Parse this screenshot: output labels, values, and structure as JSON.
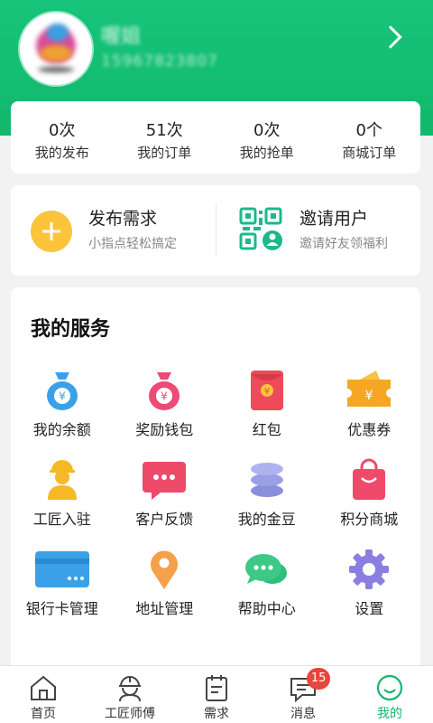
{
  "profile": {
    "name": "喔姐",
    "phone": "15967823807"
  },
  "stats": [
    {
      "value": "0次",
      "label": "我的发布"
    },
    {
      "value": "51次",
      "label": "我的订单"
    },
    {
      "value": "0次",
      "label": "我的抢单"
    },
    {
      "value": "0个",
      "label": "商城订单"
    }
  ],
  "actions": {
    "publish": {
      "title": "发布需求",
      "subtitle": "小指点轻松搞定",
      "icon": "plus-icon"
    },
    "invite": {
      "title": "邀请用户",
      "subtitle": "邀请好友领福利",
      "icon": "qr-user-icon"
    }
  },
  "services": {
    "title": "我的服务",
    "items": [
      {
        "label": "我的余额",
        "icon": "money-bag-icon"
      },
      {
        "label": "奖励钱包",
        "icon": "money-bag-icon"
      },
      {
        "label": "红包",
        "icon": "red-envelope-icon"
      },
      {
        "label": "优惠券",
        "icon": "coupon-icon"
      },
      {
        "label": "工匠入驻",
        "icon": "worker-icon"
      },
      {
        "label": "客户反馈",
        "icon": "feedback-icon"
      },
      {
        "label": "我的金豆",
        "icon": "coin-stack-icon"
      },
      {
        "label": "积分商城",
        "icon": "shopping-bag-icon"
      },
      {
        "label": "银行卡管理",
        "icon": "bank-card-icon"
      },
      {
        "label": "地址管理",
        "icon": "location-pin-icon"
      },
      {
        "label": "帮助中心",
        "icon": "chat-icon"
      },
      {
        "label": "设置",
        "icon": "gear-icon"
      }
    ]
  },
  "tabs": [
    {
      "label": "首页",
      "icon": "home-icon"
    },
    {
      "label": "工匠师傅",
      "icon": "worker-helmet-icon"
    },
    {
      "label": "需求",
      "icon": "clipboard-icon"
    },
    {
      "label": "消息",
      "icon": "message-icon",
      "badge": "15"
    },
    {
      "label": "我的",
      "icon": "smile-icon",
      "active": true
    }
  ],
  "colors": {
    "brand": "#13b86c",
    "accent_yellow": "#fbc43b",
    "badge_red": "#e8453c"
  }
}
